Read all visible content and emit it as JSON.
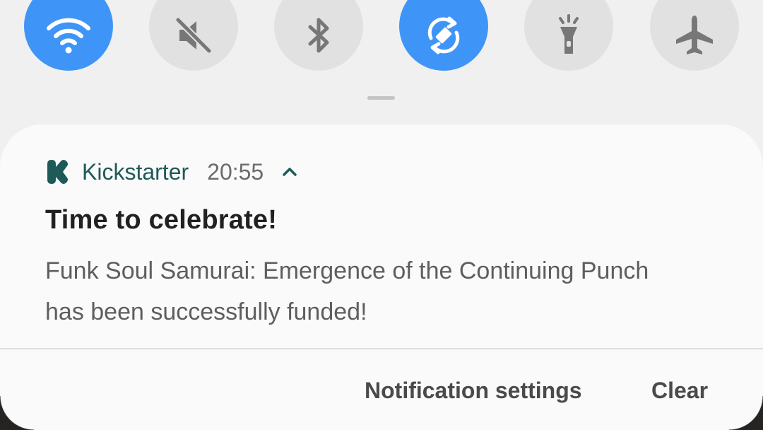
{
  "quick_settings": [
    {
      "name": "wifi",
      "icon": "wifi-icon",
      "active": true
    },
    {
      "name": "mute",
      "icon": "mute-icon",
      "active": false
    },
    {
      "name": "bluetooth",
      "icon": "bluetooth-icon",
      "active": false
    },
    {
      "name": "auto-rotate",
      "icon": "auto-rotate-icon",
      "active": true
    },
    {
      "name": "flashlight",
      "icon": "flashlight-icon",
      "active": false
    },
    {
      "name": "airplane-mode",
      "icon": "airplane-icon",
      "active": false
    }
  ],
  "colors": {
    "active_toggle": "#3f95f7",
    "inactive_toggle": "#e1e1e1",
    "app_accent": "#1e5a57"
  },
  "notification": {
    "app_icon": "kickstarter-logo-icon",
    "app_name": "Kickstarter",
    "time": "20:55",
    "title": "Time to celebrate!",
    "body_line1": "Funk Soul Samurai: Emergence of the Continuing Punch",
    "body_line2": "has been successfully funded!"
  },
  "actions": {
    "settings_label": "Notification settings",
    "clear_label": "Clear"
  }
}
